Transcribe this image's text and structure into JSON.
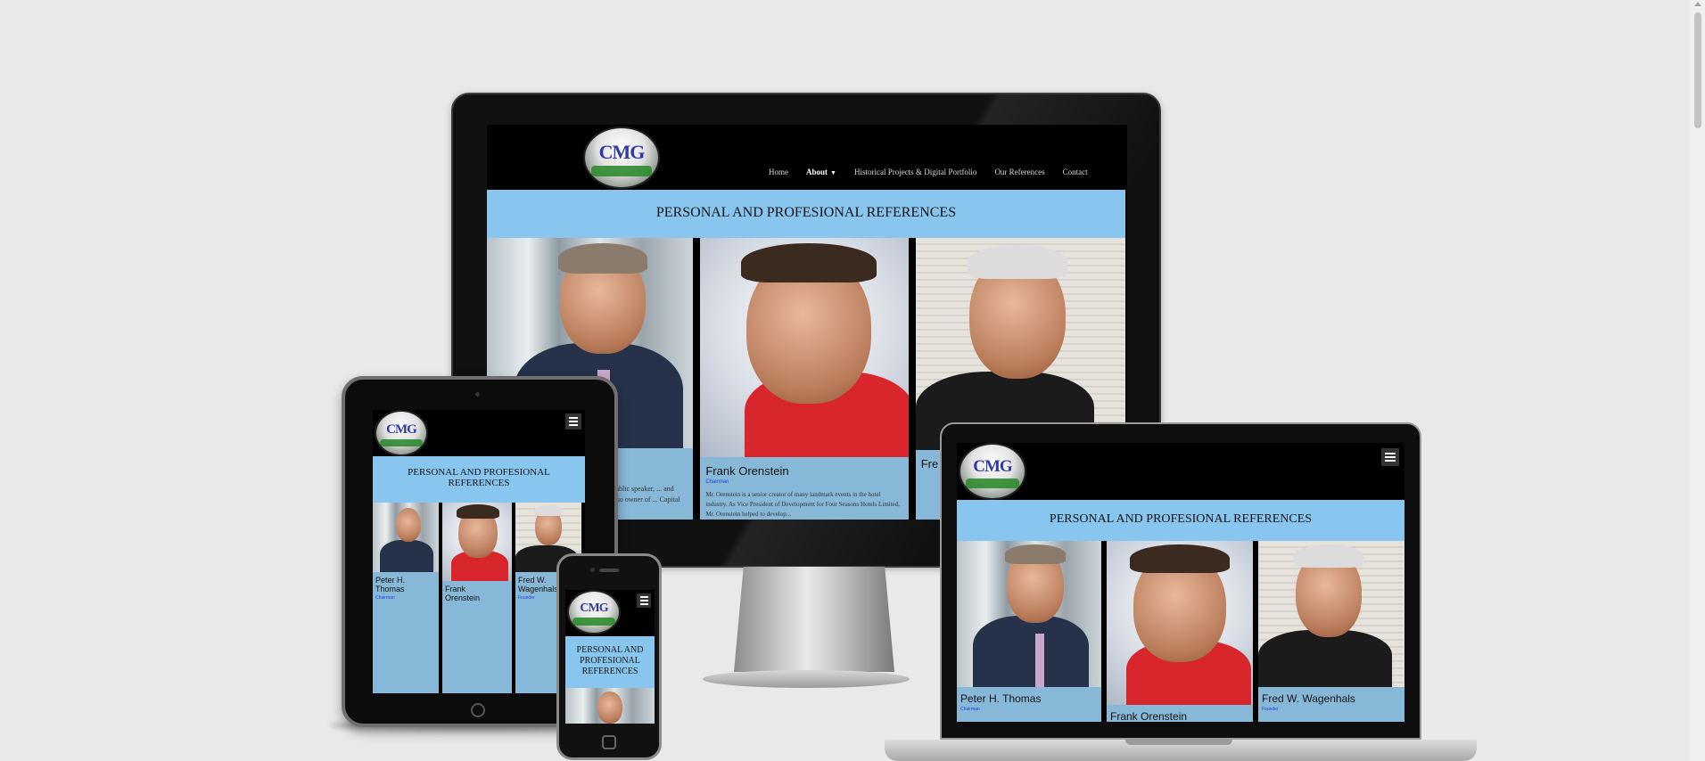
{
  "site": {
    "nav": {
      "home": "Home",
      "about": "About",
      "historical": "Historical Projects & Digital Portfolio",
      "references": "Our References",
      "contact": "Contact"
    },
    "logo_text": "CMG",
    "banner": "PERSONAL AND PROFESIONAL REFERENCES",
    "banner_tablet_line1": "PERSONAL AND PROFESIONAL",
    "banner_tablet_line2": "REFERENCES",
    "banner_phone_line1": "PERSONAL AND",
    "banner_phone_line2": "PROFESIONAL",
    "banner_phone_line3": "REFERENCES"
  },
  "references": [
    {
      "name": "Peter H. Thomas",
      "name_l1": "Peter H.",
      "name_l2": "Thomas",
      "role": "Chairman"
    },
    {
      "name": "Frank Orenstein",
      "name_l1": "Frank",
      "name_l2": "Orenstein",
      "role": "Chairman",
      "bio_desktop": "Mr. Orenstein is a senior creator of many landmark events in the hotel industry. As Vice President of Development for Four Seasons Hotels Limited, Mr. Orenstein helped to develop..."
    },
    {
      "name": "Fred W. Wagenhals",
      "name_l1": "Fred W.",
      "name_l2": "Wagenhals",
      "role": "Founder",
      "short": "Fre"
    }
  ],
  "colors": {
    "page_bg": "#e9e9e9",
    "banner_bg": "#88c6ef",
    "card_bg": "#88b8d8",
    "role_blue": "#1d3fd8"
  }
}
